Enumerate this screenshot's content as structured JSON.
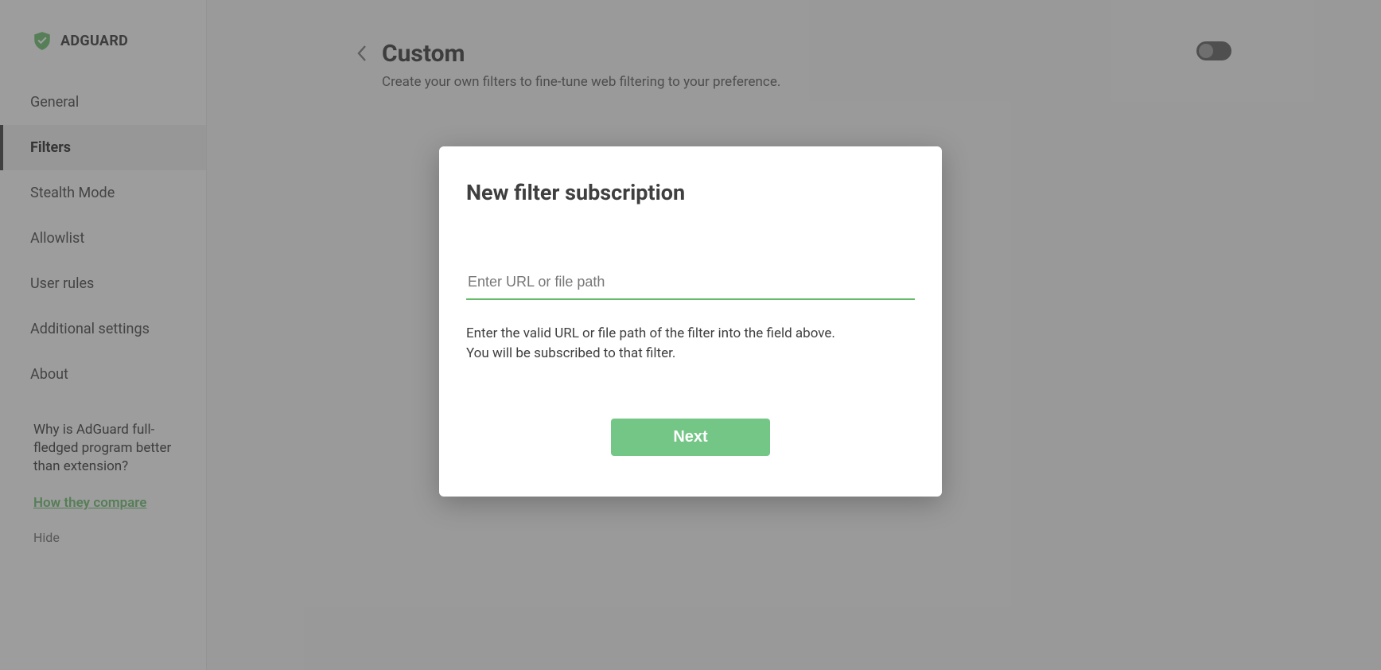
{
  "brand": "ADGUARD",
  "sidebar": {
    "items": [
      {
        "label": "General"
      },
      {
        "label": "Filters"
      },
      {
        "label": "Stealth Mode"
      },
      {
        "label": "Allowlist"
      },
      {
        "label": "User rules"
      },
      {
        "label": "Additional settings"
      },
      {
        "label": "About"
      }
    ],
    "active_index": 1,
    "promo_text": "Why is AdGuard full-fledged program better than extension?",
    "compare_label": "How they compare",
    "hide_label": "Hide"
  },
  "page": {
    "title": "Custom",
    "subtitle": "Create your own filters to fine-tune web filtering to your preference.",
    "toggle_on": false
  },
  "modal": {
    "title": "New filter subscription",
    "input_value": "",
    "input_placeholder": "Enter URL or file path",
    "hint_line1": "Enter the valid URL or file path of the filter into the field above.",
    "hint_line2": "You will be subscribed to that filter.",
    "next_label": "Next"
  }
}
